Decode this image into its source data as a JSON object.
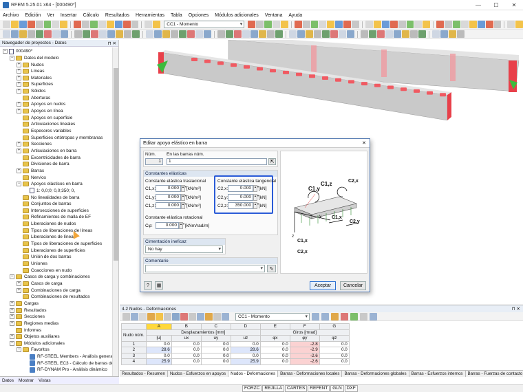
{
  "window": {
    "title": "RFEM 5.25.01 x64 - [000490*]"
  },
  "menu": [
    "Archivo",
    "Edición",
    "Ver",
    "Insertar",
    "Cálculo",
    "Resultados",
    "Herramientas",
    "Tabla",
    "Opciones",
    "Módulos adicionales",
    "Ventana",
    "Ayuda"
  ],
  "toolbar": {
    "loadcase": "CC1 - Momento"
  },
  "navigator": {
    "title": "Navegador de proyectos - Datos",
    "root": "000490*",
    "items": [
      {
        "label": "Datos del modelo",
        "level": 1,
        "expanded": true
      },
      {
        "label": "Nudos",
        "level": 2
      },
      {
        "label": "Líneas",
        "level": 2
      },
      {
        "label": "Materiales",
        "level": 2
      },
      {
        "label": "Superficies",
        "level": 2
      },
      {
        "label": "Sólidos",
        "level": 2
      },
      {
        "label": "Aberturas",
        "level": 2
      },
      {
        "label": "Apoyos en nudos",
        "level": 2
      },
      {
        "label": "Apoyos en línea",
        "level": 2
      },
      {
        "label": "Apoyos en superficie",
        "level": 2
      },
      {
        "label": "Articulaciones lineales",
        "level": 2
      },
      {
        "label": "Espesores variables",
        "level": 2
      },
      {
        "label": "Superficies ortótropas y membranas",
        "level": 2
      },
      {
        "label": "Secciones",
        "level": 2
      },
      {
        "label": "Articulaciones en barra",
        "level": 2
      },
      {
        "label": "Excentricidades de barra",
        "level": 2
      },
      {
        "label": "Divisiones de barra",
        "level": 2
      },
      {
        "label": "Barras",
        "level": 2
      },
      {
        "label": "Nervios",
        "level": 2
      },
      {
        "label": "Apoyos elásticos en barra",
        "level": 2,
        "expanded": true
      },
      {
        "label": "1: 0,0;0; 0,0;350; 0,",
        "level": 3
      },
      {
        "label": "No linealidades de barra",
        "level": 2
      },
      {
        "label": "Conjuntos de barras",
        "level": 2
      },
      {
        "label": "Intersecciones de superficies",
        "level": 2
      },
      {
        "label": "Refinamientos de malla de EF",
        "level": 2
      },
      {
        "label": "Liberaciones de nudos",
        "level": 2
      },
      {
        "label": "Tipos de liberaciones de líneas",
        "level": 2
      },
      {
        "label": "Liberaciones de líneas",
        "level": 2
      },
      {
        "label": "Tipos de liberaciones de superficies",
        "level": 2
      },
      {
        "label": "Liberaciones de superficies",
        "level": 2
      },
      {
        "label": "Unión de dos barras",
        "level": 2
      },
      {
        "label": "Uniones",
        "level": 2
      },
      {
        "label": "Coacciones en nudo",
        "level": 2
      },
      {
        "label": "Casos de carga y combinaciones",
        "level": 1,
        "expanded": true
      },
      {
        "label": "Casos de carga",
        "level": 2
      },
      {
        "label": "Combinaciones de carga",
        "level": 2
      },
      {
        "label": "Combinaciones de resultados",
        "level": 2
      },
      {
        "label": "Cargas",
        "level": 1
      },
      {
        "label": "Resultados",
        "level": 1
      },
      {
        "label": "Secciones",
        "level": 1
      },
      {
        "label": "Regiones medias",
        "level": 1
      },
      {
        "label": "Informes",
        "level": 1
      },
      {
        "label": "Objetos auxiliares",
        "level": 1
      },
      {
        "label": "Módulos adicionales",
        "level": 1,
        "expanded": true
      },
      {
        "label": "Favoritos",
        "level": 2,
        "expanded": true
      },
      {
        "label": "RF-STEEL Members - Análisis general d",
        "level": 3,
        "app": true
      },
      {
        "label": "RF-STEEL EC3 - Cálculo de barras de ac",
        "level": 3,
        "app": true
      },
      {
        "label": "RF-DYNAM Pro - Análisis dinámico",
        "level": 3,
        "app": true
      }
    ],
    "tabs": [
      "Datos",
      "Mostrar",
      "Vistas"
    ]
  },
  "dialog": {
    "title": "Editar apoyo elástico en barra",
    "num_label": "Núm.",
    "num_value": "1",
    "members_label": "En las barras núm.",
    "members_value": "1",
    "constants_title": "Constantes elásticas",
    "trans_title": "Constante elástica traslacional",
    "trans": [
      {
        "sym": "C1,x:",
        "value": "0.000",
        "unit": "[kN/m²]"
      },
      {
        "sym": "C1,y:",
        "value": "0.000",
        "unit": "[kN/m²]"
      },
      {
        "sym": "C1,z:",
        "value": "0.000",
        "unit": "[kN/m²]"
      }
    ],
    "tang_title": "Constante elástica tangencial",
    "tang": [
      {
        "sym": "C2,x:",
        "value": "0.000",
        "unit": "[kN]"
      },
      {
        "sym": "C2,y:",
        "value": "0.000",
        "unit": "[kN]"
      },
      {
        "sym": "C2,z:",
        "value": "350.000",
        "unit": "[kN]"
      }
    ],
    "rot_title": "Constante elástica rotacional",
    "rot": {
      "sym": "Cφ:",
      "value": "0.000",
      "unit": "[kNm/rad/m]"
    },
    "foundation_title": "Cimentación ineficaz",
    "foundation_value": "No hay",
    "comment_title": "Comentario",
    "comment_value": "",
    "ok": "Aceptar",
    "cancel": "Cancelar",
    "diagram_labels": {
      "c1y": "C1,y",
      "c1z": "C1,z",
      "c2x": "C2,x",
      "c1x": "C1,x",
      "c2y": "C2,y",
      "c2z": "C2,z",
      "c2x2": "C2,x",
      "x": "x",
      "y": "y",
      "z": "z"
    }
  },
  "results": {
    "panel_title": "4.2 Nudos - Deformaciones",
    "loadcase": "CC1 - Momento",
    "cols": [
      "A",
      "B",
      "C",
      "D",
      "E",
      "F",
      "G"
    ],
    "group1": "Desplazamientos [mm]",
    "group2": "Giros [mrad]",
    "head_node": "Nudo núm.",
    "headers": [
      "|u|",
      "ux",
      "uy",
      "uz",
      "φx",
      "φy",
      "φz"
    ],
    "rows": [
      {
        "n": "1",
        "v": [
          "0.0",
          "0.0",
          "0.0",
          "0.0",
          "0.0",
          "-2.8",
          "0.0"
        ]
      },
      {
        "n": "2",
        "v": [
          "28.6",
          "0.0",
          "0.0",
          "28.6",
          "0.0",
          "-2.9",
          "0.0"
        ]
      },
      {
        "n": "3",
        "v": [
          "0.0",
          "0.0",
          "0.0",
          "0.0",
          "0.0",
          "-2.6",
          "0.0"
        ]
      },
      {
        "n": "4",
        "v": [
          "25.9",
          "0.0",
          "0.0",
          "25.9",
          "0.0",
          "-2.6",
          "0.0"
        ]
      }
    ],
    "tabs": [
      "Resultados - Resumen",
      "Nudos - Esfuerzos en apoyos",
      "Nudos - Deformaciones",
      "Barras - Deformaciones locales",
      "Barras - Deformaciones globales",
      "Barras - Esfuerzos internos",
      "Barras - Fuerzas de contacto"
    ],
    "active_tab": "Nudos - Deformaciones"
  },
  "status": [
    "FORZC",
    "REJILLA",
    "CARTES",
    "REFENT",
    "GLN",
    "DXF"
  ],
  "colors": {
    "beam": "#d8d8d8",
    "support": "#e8404a",
    "accent": "#2a5bd7",
    "highlight": "#ffd83c"
  }
}
